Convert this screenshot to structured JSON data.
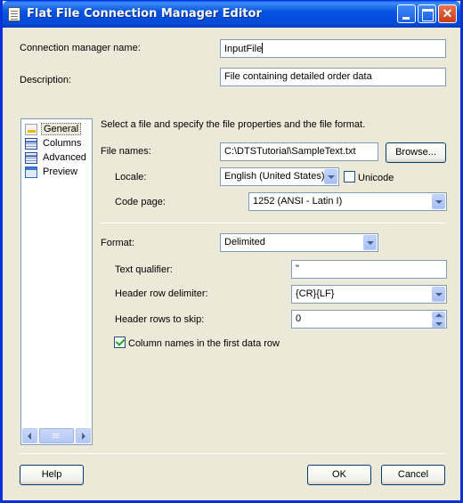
{
  "window": {
    "title": "Flat File Connection Manager Editor",
    "title_icon": "document-icon",
    "controls": {
      "minimize": "minimize",
      "maximize": "maximize",
      "close": "✕"
    }
  },
  "connection": {
    "name_label": "Connection manager name:",
    "name_value": "InputFile",
    "description_label": "Description:",
    "description_value": "File containing detailed order data"
  },
  "nav": {
    "items": [
      {
        "label": "General",
        "icon": "general-icon",
        "selected": true
      },
      {
        "label": "Columns",
        "icon": "grid-icon",
        "selected": false
      },
      {
        "label": "Advanced",
        "icon": "grid-icon",
        "selected": false
      },
      {
        "label": "Preview",
        "icon": "preview-icon",
        "selected": false
      }
    ]
  },
  "general": {
    "intro": "Select a file and specify the file properties and the file format.",
    "file_names_label": "File names:",
    "file_names_value": "C:\\DTSTutorial\\SampleText.txt",
    "browse_label": "Browse...",
    "locale_label": "Locale:",
    "locale_value": "English (United States)",
    "unicode_label": "Unicode",
    "unicode_checked": false,
    "code_page_label": "Code page:",
    "code_page_value": "1252  (ANSI - Latin I)",
    "format_label": "Format:",
    "format_value": "Delimited",
    "text_qualifier_label": "Text qualifier:",
    "text_qualifier_value": "\"",
    "header_delim_label": "Header row delimiter:",
    "header_delim_value": "{CR}{LF}",
    "header_skip_label": "Header rows to skip:",
    "header_skip_value": "0",
    "column_names_label": "Column names in the first data row",
    "column_names_checked": true
  },
  "footer": {
    "help_label": "Help",
    "ok_label": "OK",
    "cancel_label": "Cancel"
  },
  "colors": {
    "title_bar": "#0554e3",
    "dialog_bg": "#ece9d8",
    "field_border": "#7f9db9",
    "check_green": "#21a121"
  }
}
